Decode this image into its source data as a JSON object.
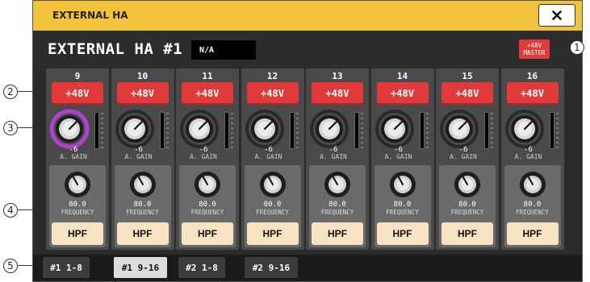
{
  "window": {
    "title": "EXTERNAL HA",
    "close_icon": "close-icon"
  },
  "header": {
    "title": "EXTERNAL HA #1",
    "na_text": "N/A",
    "master_line1": "+48V",
    "master_line2": "MASTER"
  },
  "channels": [
    {
      "number": "9",
      "phantom": "+48V",
      "gain_value": "-6",
      "gain_label": "A. GAIN",
      "freq_value": "80.0",
      "freq_label": "FREQUENCY",
      "hpf": "HPF"
    },
    {
      "number": "10",
      "phantom": "+48V",
      "gain_value": "-6",
      "gain_label": "A. GAIN",
      "freq_value": "80.0",
      "freq_label": "FREQUENCY",
      "hpf": "HPF"
    },
    {
      "number": "11",
      "phantom": "+48V",
      "gain_value": "-6",
      "gain_label": "A. GAIN",
      "freq_value": "80.0",
      "freq_label": "FREQUENCY",
      "hpf": "HPF"
    },
    {
      "number": "12",
      "phantom": "+48V",
      "gain_value": "-6",
      "gain_label": "A. GAIN",
      "freq_value": "80.0",
      "freq_label": "FREQUENCY",
      "hpf": "HPF"
    },
    {
      "number": "13",
      "phantom": "+48V",
      "gain_value": "-6",
      "gain_label": "A. GAIN",
      "freq_value": "80.0",
      "freq_label": "FREQUENCY",
      "hpf": "HPF"
    },
    {
      "number": "14",
      "phantom": "+48V",
      "gain_value": "-6",
      "gain_label": "A. GAIN",
      "freq_value": "80.0",
      "freq_label": "FREQUENCY",
      "hpf": "HPF"
    },
    {
      "number": "15",
      "phantom": "+48V",
      "gain_value": "-6",
      "gain_label": "A. GAIN",
      "freq_value": "80.0",
      "freq_label": "FREQUENCY",
      "hpf": "HPF"
    },
    {
      "number": "16",
      "phantom": "+48V",
      "gain_value": "-6",
      "gain_label": "A. GAIN",
      "freq_value": "80.0",
      "freq_label": "FREQUENCY",
      "hpf": "HPF"
    }
  ],
  "tabs": [
    {
      "label": "#1 1-8",
      "active": false
    },
    {
      "label": "#1 9-16",
      "active": true
    },
    {
      "label": "#2 1-8",
      "active": false
    },
    {
      "label": "#2 9-16",
      "active": false
    }
  ],
  "callouts": [
    "1",
    "2",
    "3",
    "4",
    "5"
  ],
  "colors": {
    "title_bar": "#f2c23a",
    "phantom_on": "#e23a3a",
    "hpf_button": "#f7e3c2",
    "selected_knob_ring": "#b040d0",
    "active_tab": "#dcdcdc"
  }
}
